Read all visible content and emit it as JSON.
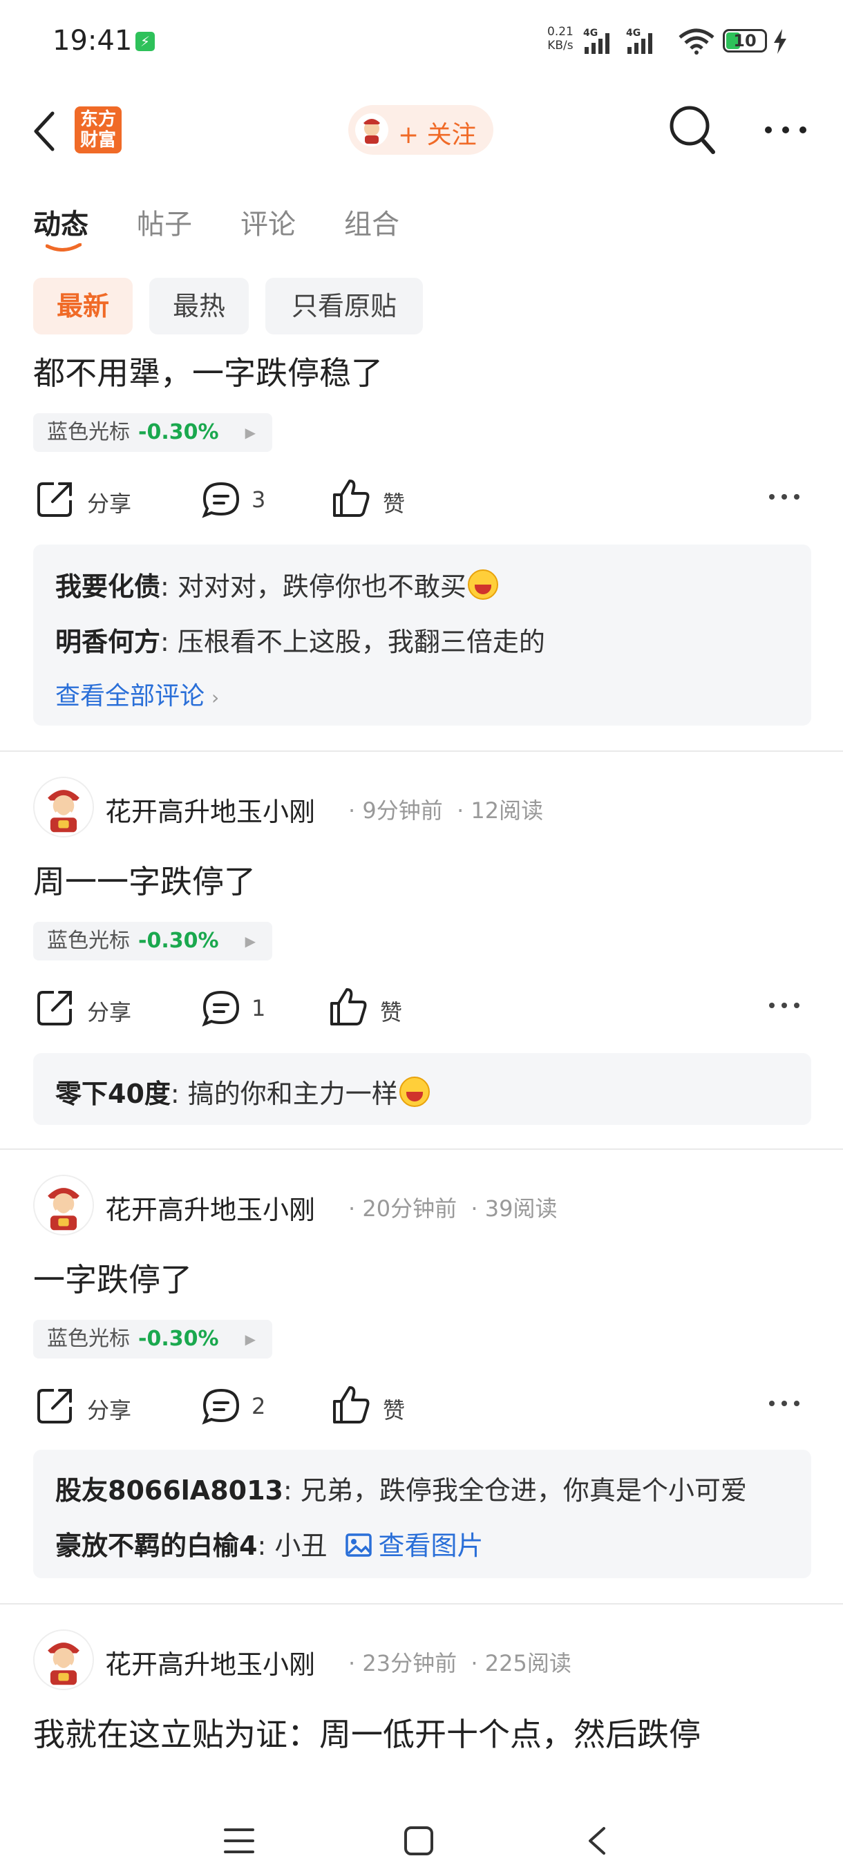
{
  "status_bar": {
    "time": "19:41",
    "net_speed_value": "0.21",
    "net_speed_unit": "KB/s",
    "sig1": "4G",
    "sig2": "4G",
    "battery": "10"
  },
  "header": {
    "logo_line1": "东方",
    "logo_line2": "财富",
    "follow_label": "+ 关注"
  },
  "tabs": [
    "动态",
    "帖子",
    "评论",
    "组合"
  ],
  "filters": [
    "最新",
    "最热",
    "只看原贴"
  ],
  "stock": {
    "name": "蓝色光标",
    "change": "-0.30%"
  },
  "actions": {
    "share": "分享",
    "like": "赞"
  },
  "posts": [
    {
      "text": "都不用犟，一字跌停稳了",
      "comment_count": "3",
      "comments": [
        {
          "author": "我要化债",
          "sep": ": ",
          "text": "对对对，跌停你也不敢买"
        },
        {
          "author": "明香何方",
          "sep": ": ",
          "text": "压根看不上这股，我翻三倍走的"
        }
      ],
      "view_all": "查看全部评论"
    },
    {
      "author": "花开高升地玉小刚",
      "time": "9分钟前",
      "reads": "12阅读",
      "text": "周一一字跌停了",
      "comment_count": "1",
      "comments": [
        {
          "author": "零下40度",
          "sep": ": ",
          "text": "搞的你和主力一样"
        }
      ]
    },
    {
      "author": "花开高升地玉小刚",
      "time": "20分钟前",
      "reads": "39阅读",
      "text": "一字跌停了",
      "comment_count": "2",
      "comments": [
        {
          "author": "股友8066lA8013",
          "sep": ": ",
          "text": "兄弟，跌停我全仓进，你真是个小可爱"
        },
        {
          "author": "豪放不羁的白榆4",
          "sep": ": ",
          "text": "小丑",
          "link": "查看图片"
        }
      ]
    },
    {
      "author": "花开高升地玉小刚",
      "time": "23分钟前",
      "reads": "225阅读",
      "text": "我就在这立贴为证：周一低开十个点，然后跌停"
    }
  ],
  "colors": {
    "accent": "#f06a27",
    "link": "#2a6fd8",
    "down": "#1aa84e"
  }
}
